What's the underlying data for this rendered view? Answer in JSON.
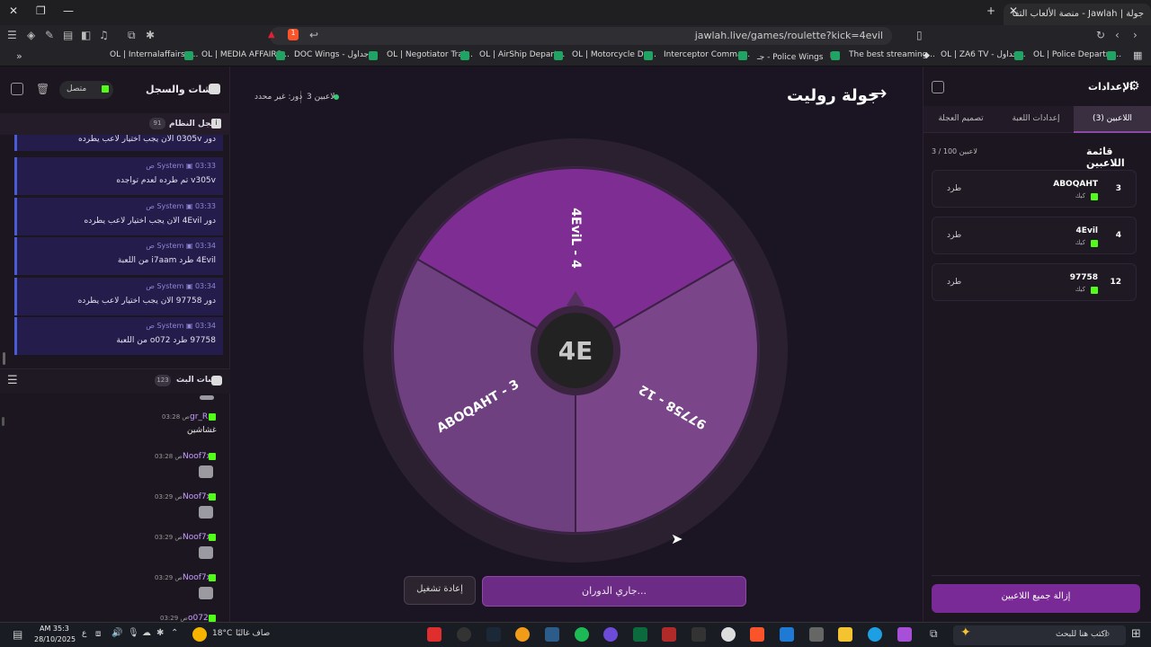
{
  "browser": {
    "tab_title": "جولة | Jawlah - منصة الألعاب التفا",
    "url": "jawlah.live/games/roulette?kick=4evil",
    "shield_count": "1",
    "bookmarks": [
      "OL | Internalaffairs -...",
      "OL | MEDIA AFFAIRS...",
      "DOC Wings - جداول...",
      "OL | Negotiator Trai...",
      "OL | AirShip Depart...",
      "OL | Motorcycle De...",
      "Interceptor Comma...",
      "جـ - Police Wings 『",
      "The best streaming...",
      "OL | ZA6 TV - جداول...",
      "OL | Police Departm..."
    ]
  },
  "chat": {
    "title": "الشات والسجل",
    "status": "متصل",
    "system_log_label": "سجل النظام",
    "system_log_count": "91",
    "partial_top": "دور 0305v الان يجب اختيار لاعب يطرده",
    "system_messages": [
      {
        "sender": "System",
        "time": "03:33 ص",
        "text": "v305v تم طرده لعدم تواجده"
      },
      {
        "sender": "System",
        "time": "03:33 ص",
        "text": "دور 4Evil الان يجب اختيار لاعب يطرده"
      },
      {
        "sender": "System",
        "time": "03:34 ص",
        "text": "4Evil طرد i7aam من اللعبة"
      },
      {
        "sender": "System",
        "time": "03:34 ص",
        "text": "دور 97758 الان يجب اختيار لاعب يطرده"
      },
      {
        "sender": "System",
        "time": "03:34 ص",
        "text": "97758 طرد o072 من اللعبة"
      }
    ],
    "live_chat_label": "شات البث",
    "live_chat_count": "123",
    "messages": [
      {
        "name": "gr_R",
        "time": "03:28 ص",
        "text": "غشاشين"
      },
      {
        "name": "Noof7x",
        "time": "03:28 ص",
        "text": ""
      },
      {
        "name": "Noof7x",
        "time": "03:29 ص",
        "text": ""
      },
      {
        "name": "Noof7x",
        "time": "03:29 ص",
        "text": ""
      },
      {
        "name": "Noof7x",
        "time": "03:29 ص",
        "text": ""
      },
      {
        "name": "o072",
        "time": "03:29 ص",
        "text": ""
      }
    ]
  },
  "game": {
    "title": "جولة روليت",
    "players_label": "3 لاعبين",
    "turn_label": "دور: غير محدد",
    "center_logo": "4E",
    "wheel_segments": [
      {
        "label": "4EviL - 4",
        "color": "#7e2d93"
      },
      {
        "label": "97758 - 12",
        "color": "#7b4589"
      },
      {
        "label": "ABOQAHT - 3",
        "color": "#6f4080"
      }
    ],
    "spin_button": "جاري الدوران...",
    "replay_button": "إعادة تشغيل"
  },
  "settings": {
    "title": "الإعدادات",
    "tabs": [
      "اللاعبين (3)",
      "إعدادات اللعبة",
      "تصميم العجلة"
    ],
    "active_tab": 0,
    "list_title": "قائمة اللاعبين",
    "count_label": "3 / 100 لاعبين",
    "players": [
      {
        "num": "3",
        "name": "ABOQAHT",
        "platform": "كيك",
        "action": "طرد"
      },
      {
        "num": "4",
        "name": "4Evil",
        "platform": "كيك",
        "action": "طرد"
      },
      {
        "num": "12",
        "name": "97758",
        "platform": "كيك",
        "action": "طرد"
      }
    ],
    "remove_all": "إزالة جميع اللاعبين"
  },
  "taskbar": {
    "search_placeholder": "اكتب هنا للبحث",
    "weather": "صاف غالبًا",
    "temp": "18°C",
    "time": "AM 35:3",
    "date": "28/10/2025",
    "lang": "ع"
  }
}
